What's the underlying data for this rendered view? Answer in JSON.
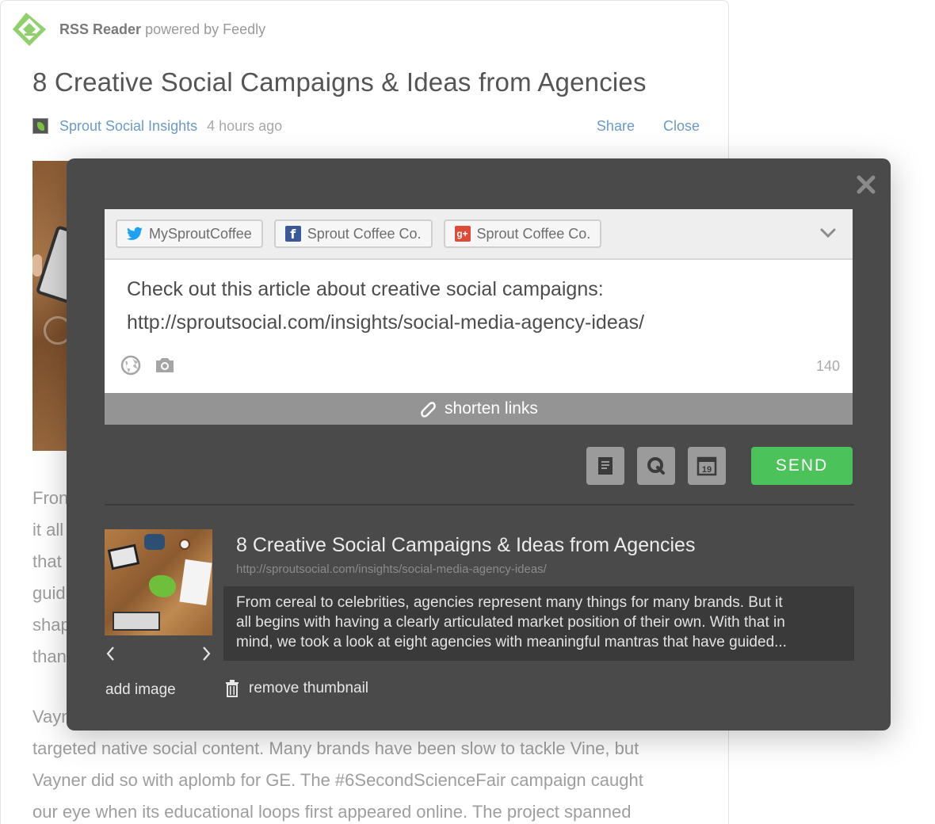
{
  "app": {
    "name": "RSS Reader",
    "powered_by": "powered by Feedly"
  },
  "article": {
    "title": "8 Creative Social Campaigns & Ideas from Agencies",
    "source": "Sprout Social Insights",
    "time": "4 hours ago",
    "share_label": "Share",
    "close_label": "Close",
    "body_fragments": [
      "Fron",
      "it all",
      "that",
      "guid",
      "shap",
      "than"
    ],
    "paragraph": [
      "Vayn",
      "targeted native social content. Many brands have been slow to tackle Vine, but",
      "Vayner did so with aplomb for GE. The #6SecondScienceFair campaign caught",
      "our eye when its educational loops first appeared online. The project spanned"
    ]
  },
  "compose": {
    "profiles": [
      {
        "network": "twitter",
        "name": "MySproutCoffee",
        "icon": "twitter-icon"
      },
      {
        "network": "facebook",
        "name": "Sprout Coffee Co.",
        "icon": "facebook-icon"
      },
      {
        "network": "google-plus",
        "name": "Sprout Coffee Co.",
        "icon": "google-plus-icon"
      }
    ],
    "message_line1": "Check out this article about creative social campaigns:",
    "message_line2": "http://sproutsocial.com/insights/social-media-agency-ideas/",
    "char_count": "140",
    "shorten_label": "shorten links",
    "send_label": "SEND",
    "action_icons": [
      "draft-icon",
      "queue-icon",
      "calendar-icon"
    ],
    "calendar_day": "19"
  },
  "link_preview": {
    "title": "8 Creative Social Campaigns & Ideas from Agencies",
    "url": "http://sproutsocial.com/insights/social-media-agency-ideas/",
    "description": [
      "From cereal to celebrities, agencies represent many things for many brands. But it",
      "all begins with having a clearly articulated market position of their own. With that in",
      "mind, we took a look at eight agencies with meaningful mantras that have guided..."
    ],
    "add_image_label": "add image",
    "remove_thumbnail_label": "remove thumbnail"
  },
  "colors": {
    "brand_green": "#6cc04a",
    "link_blue": "#6b9ac8",
    "modal_bg": "#4a4a4a",
    "send_green": "#4cc35a",
    "twitter_blue": "#1da1f2",
    "facebook_blue": "#3b5998",
    "google_red": "#dd4b39"
  }
}
